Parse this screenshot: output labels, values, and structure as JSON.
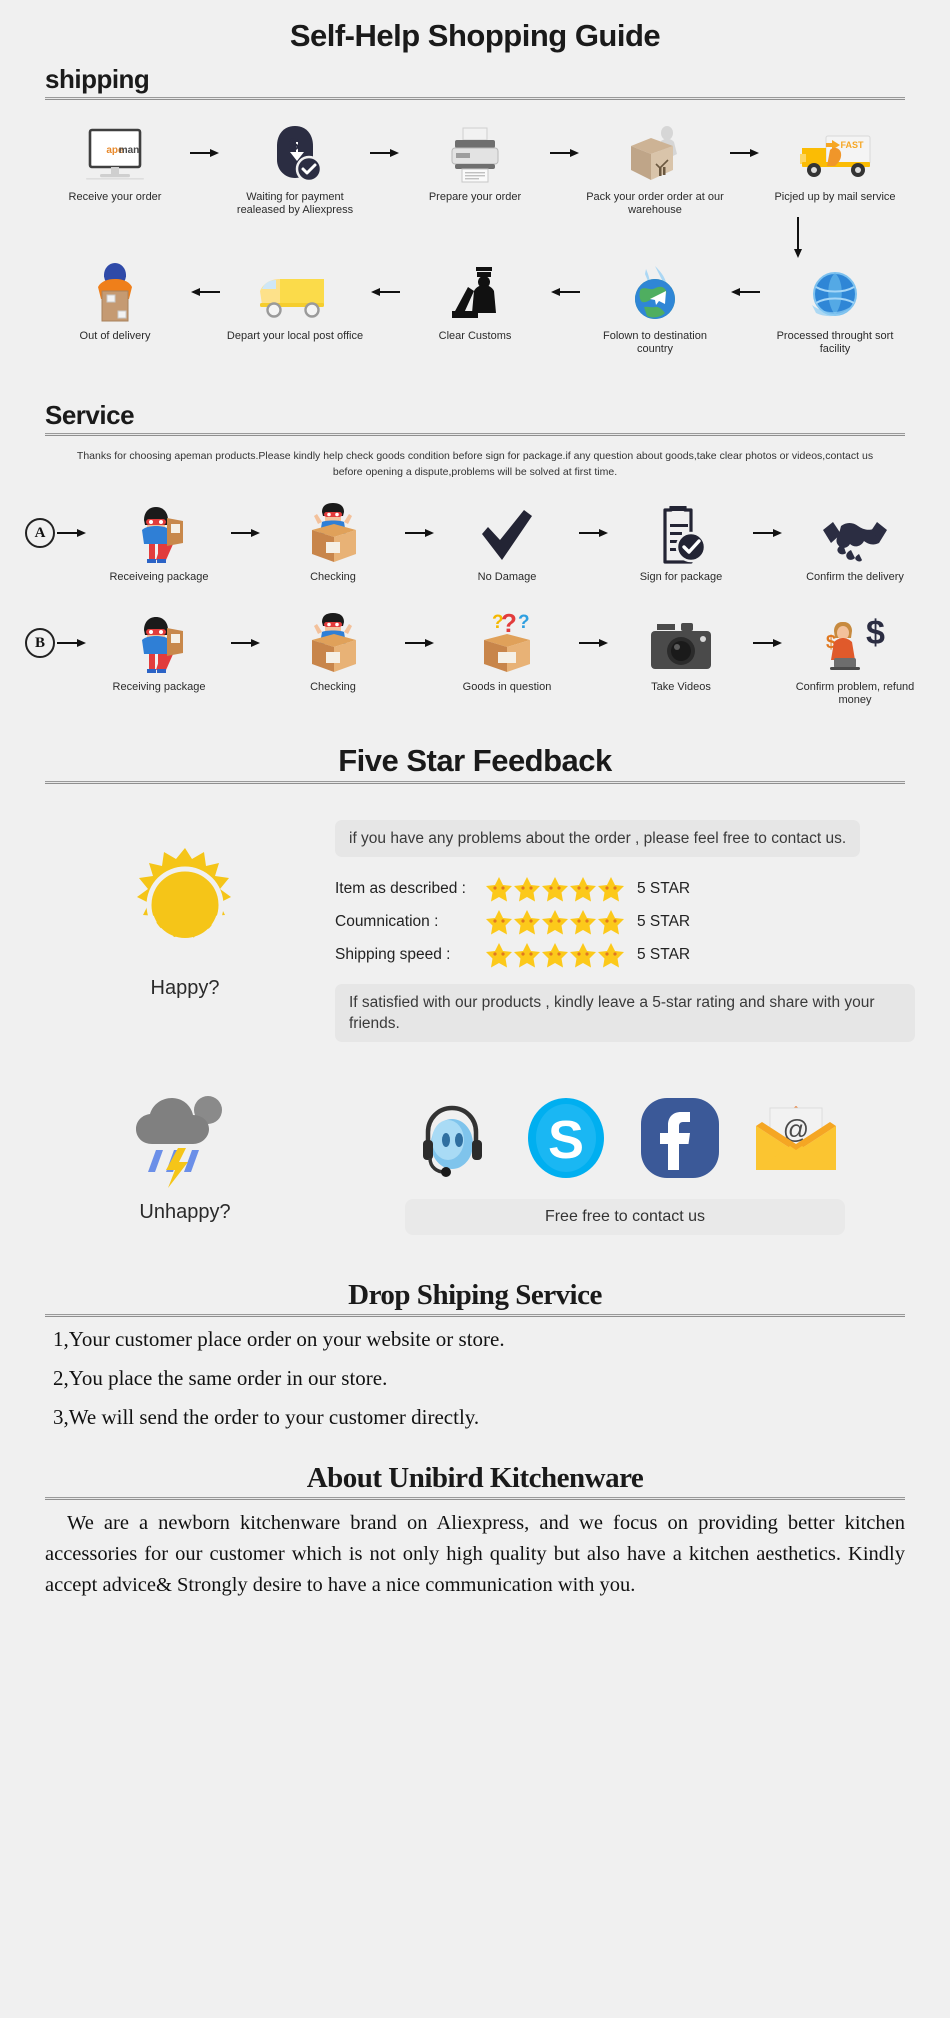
{
  "page": {
    "title": "Self-Help Shopping Guide",
    "background_color": "#f0f0f0"
  },
  "shipping": {
    "heading": "shipping",
    "row1": [
      {
        "caption": "Receive your order",
        "icon": "monitor-apeman-icon",
        "brand_text": "apeman"
      },
      {
        "caption": "Waiting for payment realeased by Aliexpress",
        "icon": "payment-shield-dollar-icon"
      },
      {
        "caption": "Prepare your order",
        "icon": "printer-icon"
      },
      {
        "caption": "Pack your order order at our warehouse",
        "icon": "packing-box-worker-icon"
      },
      {
        "caption": "Picjed up by mail service",
        "icon": "delivery-truck-fast-icon",
        "badge_text": "FAST"
      }
    ],
    "row2": [
      {
        "caption": "Out of delivery",
        "icon": "courier-carrying-box-icon"
      },
      {
        "caption": "Depart your local post office",
        "icon": "yellow-van-icon"
      },
      {
        "caption": "Clear Customs",
        "icon": "customs-officer-icon"
      },
      {
        "caption": "Folown to destination country",
        "icon": "globe-airplane-icon"
      },
      {
        "caption": "Processed throught sort facility",
        "icon": "blue-globe-sorting-icon"
      }
    ]
  },
  "service": {
    "heading": "Service",
    "note": "Thanks for choosing apeman products.Please kindly help check goods condition before sign for package.if any question about goods,take clear photos or videos,contact us before opening a dispute,problems will be solved at first time.",
    "rowA": {
      "badge": "A",
      "steps": [
        {
          "caption": "Receiveing package",
          "icon": "superhero-receiving-package-icon"
        },
        {
          "caption": "Checking",
          "icon": "superhero-checking-box-icon"
        },
        {
          "caption": "No Damage",
          "icon": "checkmark-icon"
        },
        {
          "caption": "Sign for package",
          "icon": "clipboard-check-icon"
        },
        {
          "caption": "Confirm the delivery",
          "icon": "handshake-icon"
        }
      ]
    },
    "rowB": {
      "badge": "B",
      "steps": [
        {
          "caption": "Receiving package",
          "icon": "superhero-receiving-package-icon"
        },
        {
          "caption": "Checking",
          "icon": "superhero-checking-box-icon"
        },
        {
          "caption": "Goods in question",
          "icon": "box-question-marks-icon"
        },
        {
          "caption": "Take Videos",
          "icon": "camera-icon"
        },
        {
          "caption": "Confirm problem, refund money",
          "icon": "agent-refund-dollar-icon"
        }
      ]
    }
  },
  "feedback": {
    "heading": "Five Star Feedback",
    "bubble_top": "if you have any problems about the order , please feel free to contact us.",
    "bubble_bottom": "If satisfied with our products , kindly leave a 5-star rating and share with your friends.",
    "happy_label": "Happy?",
    "unhappy_label": "Unhappy?",
    "sun_color": "#f5c518",
    "cloud_color": "#808080",
    "ratings": [
      {
        "label": "Item as described :",
        "stars": 5,
        "value": "5 STAR"
      },
      {
        "label": "Coumnication :",
        "stars": 5,
        "value": "5 STAR"
      },
      {
        "label": "Shipping speed :",
        "stars": 5,
        "value": "5 STAR"
      }
    ],
    "socials": [
      {
        "name": "headset-support-icon",
        "color": "#5aa9e6"
      },
      {
        "name": "skype-icon",
        "color": "#00aff0"
      },
      {
        "name": "facebook-icon",
        "color": "#3b5998"
      },
      {
        "name": "email-envelope-icon",
        "color": "#f5b800"
      }
    ],
    "contact_button": "Free free to contact us"
  },
  "dropshipping": {
    "heading": "Drop Shiping Service",
    "items": [
      "1,Your customer place order on your website or store.",
      "2,You place the same order in our store.",
      "3,We will send the order to your customer directly."
    ]
  },
  "about": {
    "heading": "About Unibird Kitchenware",
    "body": "We are a newborn kitchenware brand on Aliexpress, and we focus on providing better kitchen accessories for our customer which is not only high quality but also have a kitchen aesthetics. Kindly accept advice& Strongly desire to have a nice communication with you."
  }
}
